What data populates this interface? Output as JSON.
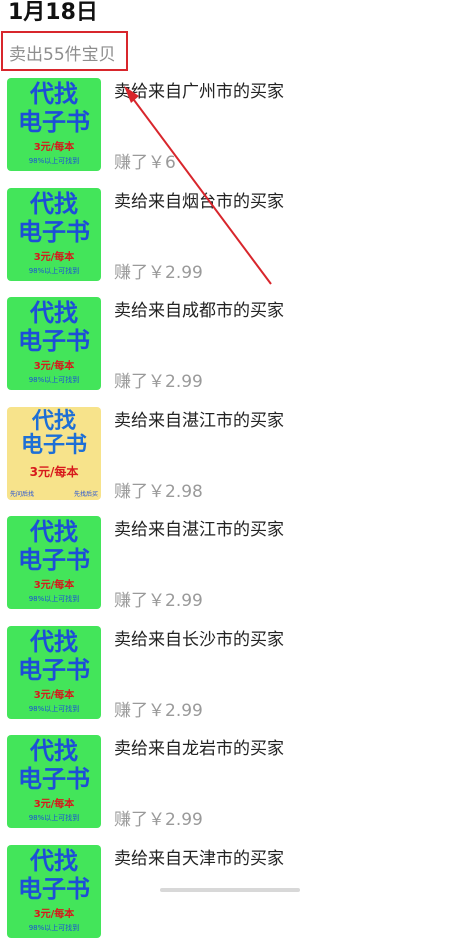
{
  "header": {
    "date": "1月18日",
    "sold_count": "卖出55件宝贝"
  },
  "colors": {
    "accent_red": "#d8262c",
    "thumb_green": "#43e55a",
    "thumb_yellow": "#f7e38b"
  },
  "orders": [
    {
      "title": "卖给来自广州市的买家",
      "earned": "赚了￥6",
      "thumb": {
        "style": "green",
        "line1": "代找",
        "line2": "电子书",
        "price": "3元/每本",
        "note": "98%以上可找到"
      }
    },
    {
      "title": "卖给来自烟台市的买家",
      "earned": "赚了￥2.99",
      "thumb": {
        "style": "green",
        "line1": "代找",
        "line2": "电子书",
        "price": "3元/每本",
        "note": "98%以上可找到"
      }
    },
    {
      "title": "卖给来自成都市的买家",
      "earned": "赚了￥2.99",
      "thumb": {
        "style": "green",
        "line1": "代找",
        "line2": "电子书",
        "price": "3元/每本",
        "note": "98%以上可找到"
      }
    },
    {
      "title": "卖给来自湛江市的买家",
      "earned": "赚了￥2.98",
      "thumb": {
        "style": "yellow",
        "line1": "代找",
        "line2": "电子书",
        "price": "3元/每本",
        "note_left": "先问后找",
        "note_right": "先找后买"
      }
    },
    {
      "title": "卖给来自湛江市的买家",
      "earned": "赚了￥2.99",
      "thumb": {
        "style": "green",
        "line1": "代找",
        "line2": "电子书",
        "price": "3元/每本",
        "note": "98%以上可找到"
      }
    },
    {
      "title": "卖给来自长沙市的买家",
      "earned": "赚了￥2.99",
      "thumb": {
        "style": "green",
        "line1": "代找",
        "line2": "电子书",
        "price": "3元/每本",
        "note": "98%以上可找到"
      }
    },
    {
      "title": "卖给来自龙岩市的买家",
      "earned": "赚了￥2.99",
      "thumb": {
        "style": "green",
        "line1": "代找",
        "line2": "电子书",
        "price": "3元/每本",
        "note": "98%以上可找到"
      }
    },
    {
      "title": "卖给来自天津市的买家",
      "earned": "",
      "thumb": {
        "style": "green",
        "line1": "代找",
        "line2": "电子书",
        "price": "3元/每本",
        "note": "98%以上可找到"
      }
    }
  ]
}
